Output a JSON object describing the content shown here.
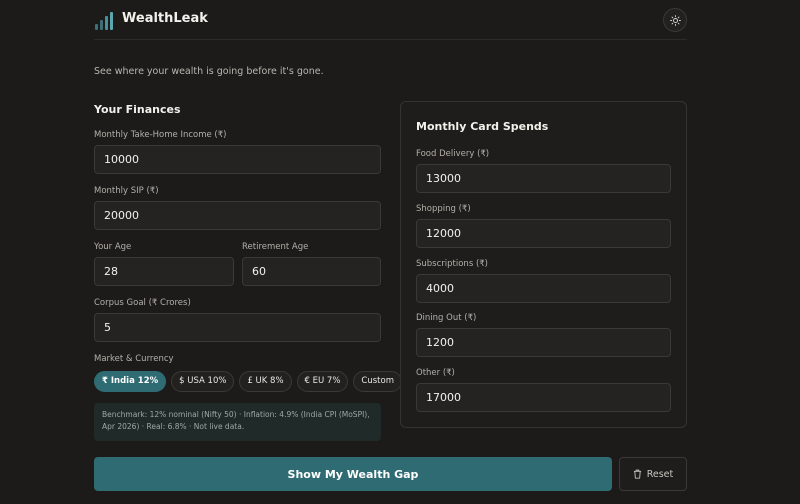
{
  "header": {
    "brand": "WealthLeak",
    "theme_icon": "sun-icon",
    "logo_icon": "bar-chart-logo-icon"
  },
  "tagline": "See where your wealth is going before it's gone.",
  "finances": {
    "title": "Your Finances",
    "income": {
      "label": "Monthly Take-Home Income (₹)",
      "value": "10000"
    },
    "sip": {
      "label": "Monthly SIP (₹)",
      "value": "20000"
    },
    "age": {
      "label": "Your Age",
      "value": "28"
    },
    "retirement_age": {
      "label": "Retirement Age",
      "value": "60"
    },
    "corpus_goal": {
      "label": "Corpus Goal (₹ Crores)",
      "value": "5"
    },
    "market": {
      "label": "Market & Currency",
      "options": [
        "₹ India 12%",
        "$ USA 10%",
        "£ UK 8%",
        "€ EU 7%",
        "Custom"
      ],
      "selected": "₹ India 12%"
    },
    "benchmark_note": "Benchmark: 12% nominal (Nifty 50) · Inflation: 4.9% (India CPI (MoSPI), Apr 2026) · Real: 6.8% · Not live data."
  },
  "card_spends": {
    "title": "Monthly Card Spends",
    "items": [
      {
        "label": "Food Delivery (₹)",
        "value": "13000"
      },
      {
        "label": "Shopping (₹)",
        "value": "12000"
      },
      {
        "label": "Subscriptions (₹)",
        "value": "4000"
      },
      {
        "label": "Dining Out (₹)",
        "value": "1200"
      },
      {
        "label": "Other (₹)",
        "value": "17000"
      }
    ]
  },
  "actions": {
    "primary": "Show My Wealth Gap",
    "reset": "Reset",
    "reset_icon": "trash-icon"
  },
  "colors": {
    "background": "#1c1b19",
    "accent": "#2f6b73",
    "surface": "#242321"
  }
}
